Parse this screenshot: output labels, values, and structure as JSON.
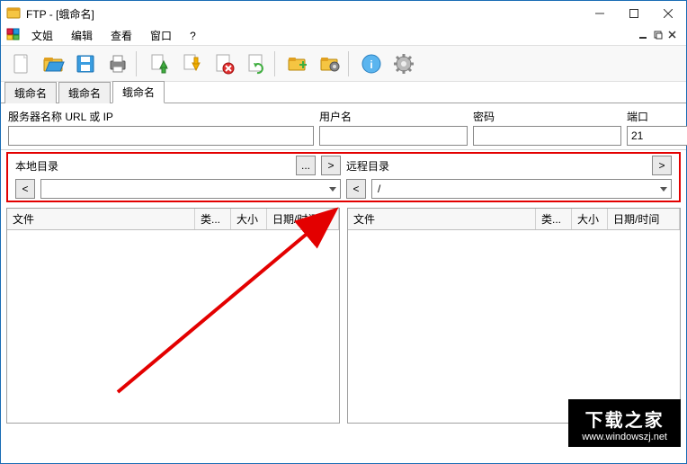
{
  "title": "FTP - [蛾命名]",
  "menu": [
    "文姐",
    "编辑",
    "查看",
    "窗口",
    "?"
  ],
  "tabs": [
    "蛾命名",
    "蛾命名",
    "蛾命名"
  ],
  "active_tab": 2,
  "conn": {
    "server_label": "服务器名称 URL 或 IP",
    "user_label": "用户名",
    "pass_label": "密码",
    "port_label": "端口",
    "server": "",
    "user": "",
    "pass": "",
    "port": "21",
    "browse": "...",
    "go": ">",
    "close": "X"
  },
  "local": {
    "label": "本地目录",
    "browse": "...",
    "go": ">",
    "back": "<",
    "path": ""
  },
  "remote": {
    "label": "远程目录",
    "go": ">",
    "back": "<",
    "path": "/"
  },
  "file_cols": {
    "file": "文件",
    "ext": "类...",
    "size": "大小",
    "date": "日期/时间"
  },
  "watermark": {
    "title": "下载之家",
    "url": "www.windowszj.net"
  }
}
